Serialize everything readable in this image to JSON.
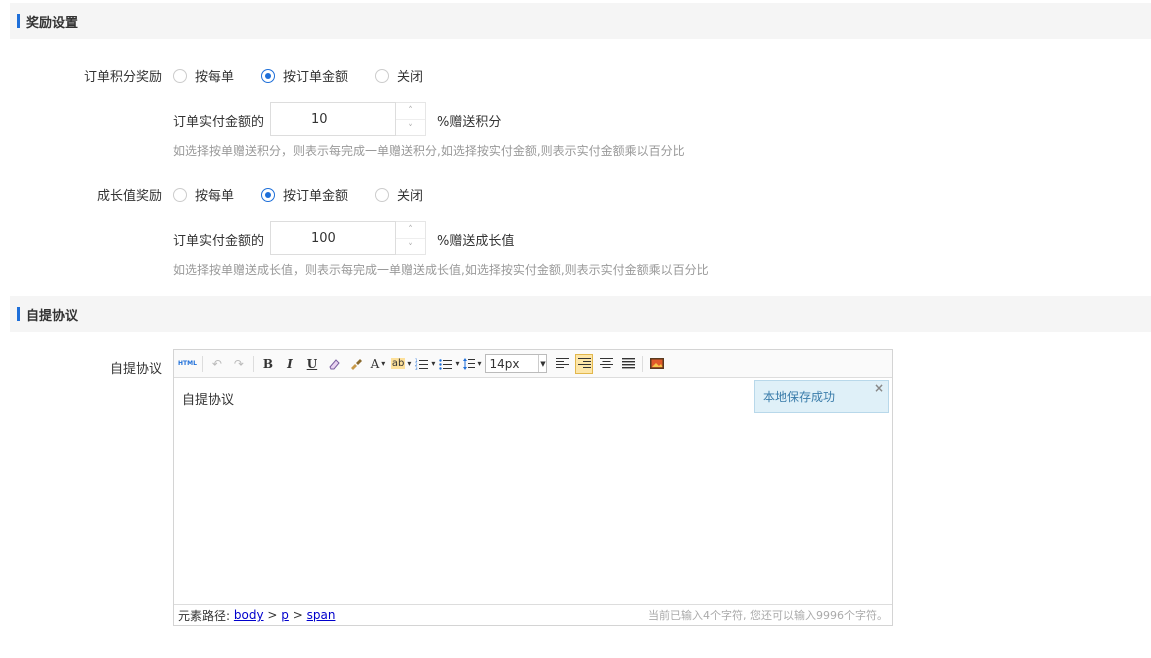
{
  "reward_section": {
    "title": "奖励设置"
  },
  "order_points": {
    "label": "订单积分奖励",
    "options": [
      "按每单",
      "按订单金额",
      "关闭"
    ],
    "selected_index": 1,
    "amount_label": "订单实付金额的",
    "value": "10",
    "suffix": "%赠送积分",
    "hint": "如选择按单赠送积分，则表示每完成一单赠送积分,如选择按实付金额,则表示实付金额乘以百分比"
  },
  "growth": {
    "label": "成长值奖励",
    "options": [
      "按每单",
      "按订单金额",
      "关闭"
    ],
    "selected_index": 1,
    "amount_label": "订单实付金额的",
    "value": "100",
    "suffix": "%赠送成长值",
    "hint": "如选择按单赠送成长值，则表示每完成一单赠送成长值,如选择按实付金额,则表示实付金额乘以百分比"
  },
  "pickup_section": {
    "title": "自提协议"
  },
  "pickup": {
    "label": "自提协议",
    "editor": {
      "toolbar": {
        "html_label": "HTML",
        "bold": "B",
        "italic": "I",
        "underline": "U",
        "font_color": "A",
        "highlight": "ab",
        "font_size": "14px"
      },
      "content": "自提协议",
      "toast": "本地保存成功",
      "toast_close": "×",
      "path_label": "元素路径:",
      "path": [
        "body",
        "p",
        "span"
      ],
      "path_sep": ">",
      "counter": "当前已输入4个字符, 您还可以输入9996个字符。"
    }
  },
  "colors": {
    "accent": "#1e6fd9"
  },
  "icons": [
    "up-arrow-icon",
    "down-arrow-icon",
    "undo-icon",
    "redo-icon",
    "eraser-icon",
    "format-brush-icon",
    "ordered-list-icon",
    "unordered-list-icon",
    "line-height-icon",
    "align-left-icon",
    "align-right-icon",
    "align-center-icon",
    "align-justify-icon",
    "image-icon",
    "close-icon"
  ]
}
